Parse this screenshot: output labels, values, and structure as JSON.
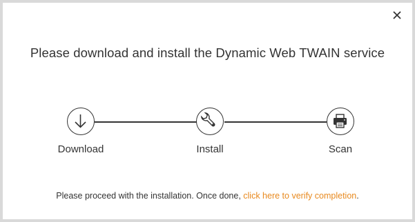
{
  "dialog": {
    "title": "Please download and install the Dynamic Web TWAIN service",
    "close_icon": "close-icon"
  },
  "steps": [
    {
      "label": "Download",
      "icon": "download-arrow-icon"
    },
    {
      "label": "Install",
      "icon": "wrench-icon"
    },
    {
      "label": "Scan",
      "icon": "printer-icon"
    }
  ],
  "footer": {
    "text": "Please proceed with the installation. Once done, ",
    "link_text": "click here to verify completion",
    "suffix": "."
  },
  "colors": {
    "text": "#333333",
    "link": "#e8891e",
    "background": "#ffffff",
    "frame": "#d9d9d9"
  }
}
